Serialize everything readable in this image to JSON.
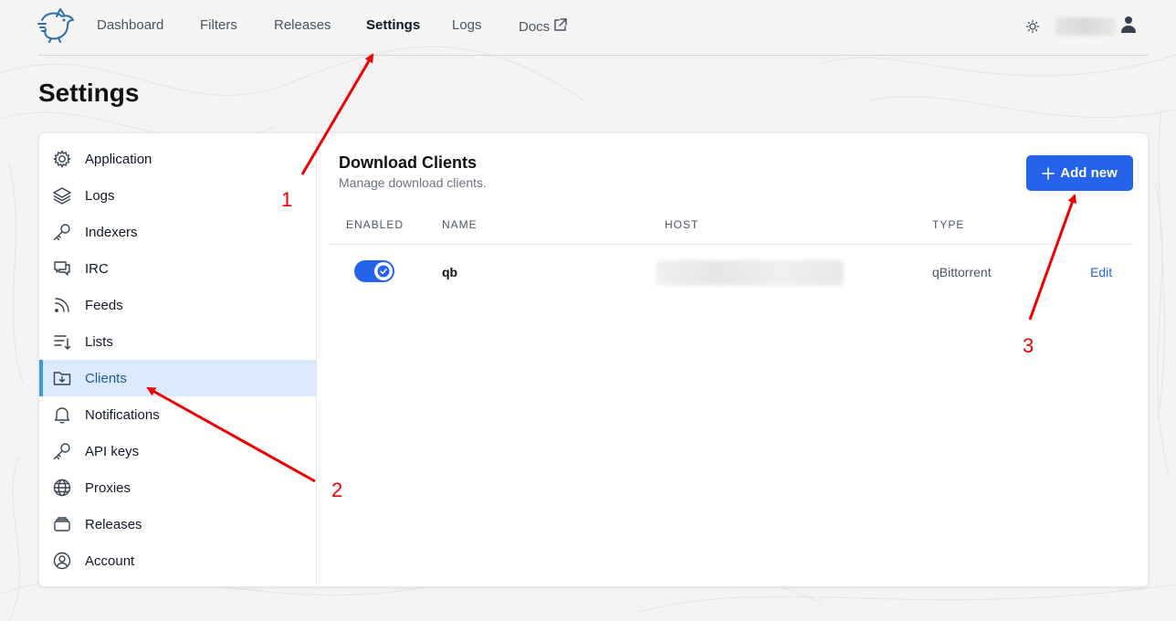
{
  "nav": {
    "links": [
      "Dashboard",
      "Filters",
      "Releases",
      "Settings",
      "Logs",
      "Docs"
    ],
    "active": "Settings"
  },
  "page": {
    "title": "Settings"
  },
  "sidebar": {
    "items": [
      {
        "label": "Application",
        "icon": "cog-icon"
      },
      {
        "label": "Logs",
        "icon": "stack-icon"
      },
      {
        "label": "Indexers",
        "icon": "key-icon"
      },
      {
        "label": "IRC",
        "icon": "chat-icon"
      },
      {
        "label": "Feeds",
        "icon": "rss-icon"
      },
      {
        "label": "Lists",
        "icon": "list-icon"
      },
      {
        "label": "Clients",
        "icon": "folder-download-icon"
      },
      {
        "label": "Notifications",
        "icon": "bell-icon"
      },
      {
        "label": "API keys",
        "icon": "key-icon"
      },
      {
        "label": "Proxies",
        "icon": "globe-icon"
      },
      {
        "label": "Releases",
        "icon": "archive-icon"
      },
      {
        "label": "Account",
        "icon": "user-circle-icon"
      }
    ],
    "active": "Clients"
  },
  "main": {
    "title": "Download Clients",
    "subtitle": "Manage download clients.",
    "add_button": "Add new",
    "columns": [
      "ENABLED",
      "NAME",
      "HOST",
      "TYPE"
    ],
    "rows": [
      {
        "enabled": true,
        "name": "qb",
        "type": "qBittorrent",
        "action": "Edit"
      }
    ]
  },
  "annotations": [
    "1",
    "2",
    "3"
  ],
  "colors": {
    "accent": "#2563eb",
    "active_bg": "#dbeafe",
    "active_bar": "#3b9ad9",
    "annotation": "#ee0000"
  }
}
